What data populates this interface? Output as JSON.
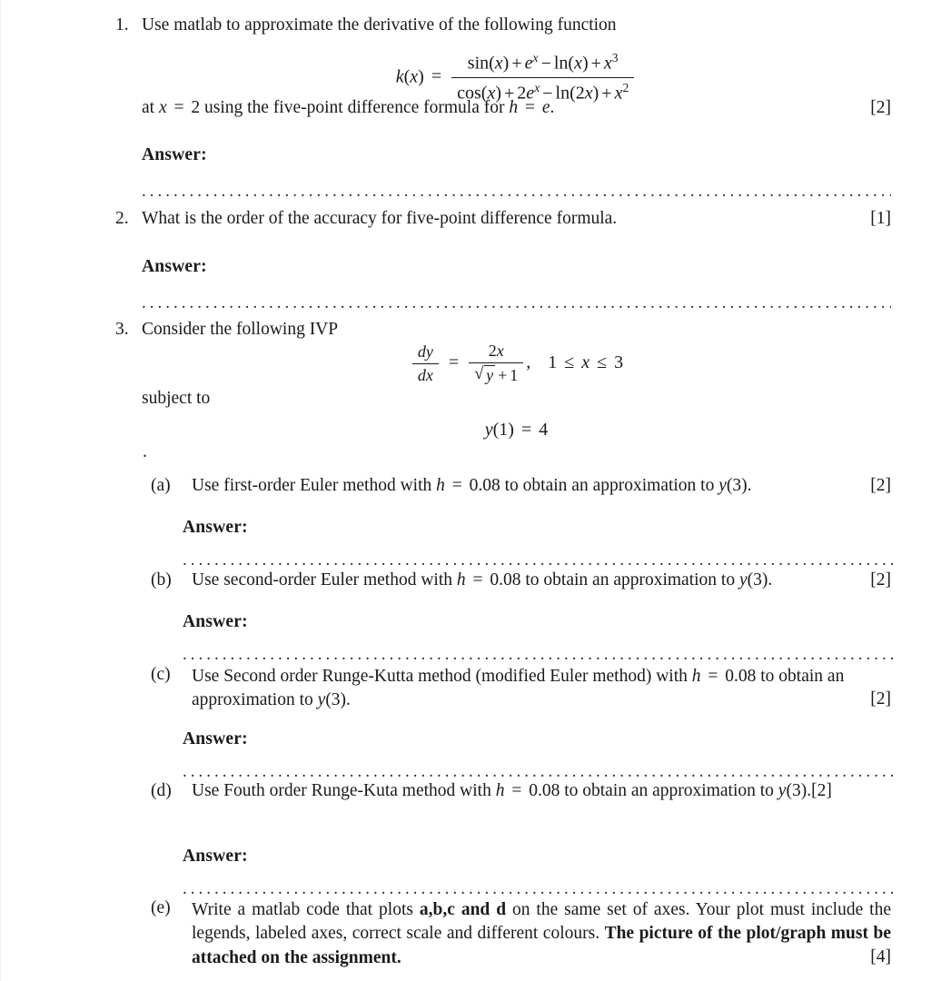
{
  "document": {
    "type": "numerical-methods-assignment",
    "page_background": "#ffffff",
    "text_color": "#1a1a1a"
  },
  "answer_label": "Answer:",
  "dots_full": "...............................................................................................................",
  "dots_indented": "........................................................................................................",
  "questions": [
    {
      "number": "1.",
      "text_before": "Use matlab to approximate the derivative of the following function",
      "equation": {
        "lhs": "k(x)",
        "equals": "=",
        "numerator": "sin(x) + e^x − ln(x) + x³",
        "denominator": "cos(x) + 2e^x − ln(2x) + x²"
      },
      "text_after": "at x = 2 using the five-point difference formula for h = e.",
      "marks": "[2]"
    },
    {
      "number": "2.",
      "text": "What is the order of the accuracy for five-point difference formula.",
      "marks": "[1]"
    },
    {
      "number": "3.",
      "text": "Consider the following IVP",
      "ode": {
        "lhs_num": "dy",
        "lhs_den": "dx",
        "equals": "=",
        "rhs_num": "2x",
        "rhs_den": "√y + 1",
        "comma": ",",
        "domain": "1 ≤ x ≤ 3"
      },
      "subject_to": "subject to",
      "initial_condition": "y(1) = 4",
      "stray_mark": ".",
      "subitems": [
        {
          "label": "(a)",
          "text": "Use first-order Euler method with h = 0.08 to obtain an approximation to y(3).",
          "marks": "[2]",
          "marks_inline": false
        },
        {
          "label": "(b)",
          "text": "Use second-order Euler method with h = 0.08 to obtain an approximation to y(3).",
          "marks": "[2]",
          "marks_inline": false
        },
        {
          "label": "(c)",
          "text": "Use Second order Runge-Kutta method (modified Euler method) with h = 0.08 to obtain an approximation to y(3).",
          "marks": "[2]",
          "marks_inline": false
        },
        {
          "label": "(d)",
          "text": "Use Fouth order Runge-Kuta method with h = 0.08 to obtain an approximation to y(3).",
          "marks": "[2]",
          "marks_inline": true
        },
        {
          "label": "(e)",
          "text_part1": "Write a matlab code that plots ",
          "bold_part1": "a,b,c and d",
          "text_part2": " on the same set of axes. Your plot must include the legends, labeled axes, correct scale and different colours. ",
          "bold_part2": "The picture of the plot/graph must be attached on the assignment.",
          "marks": "[4]",
          "marks_inline": false
        }
      ]
    }
  ]
}
